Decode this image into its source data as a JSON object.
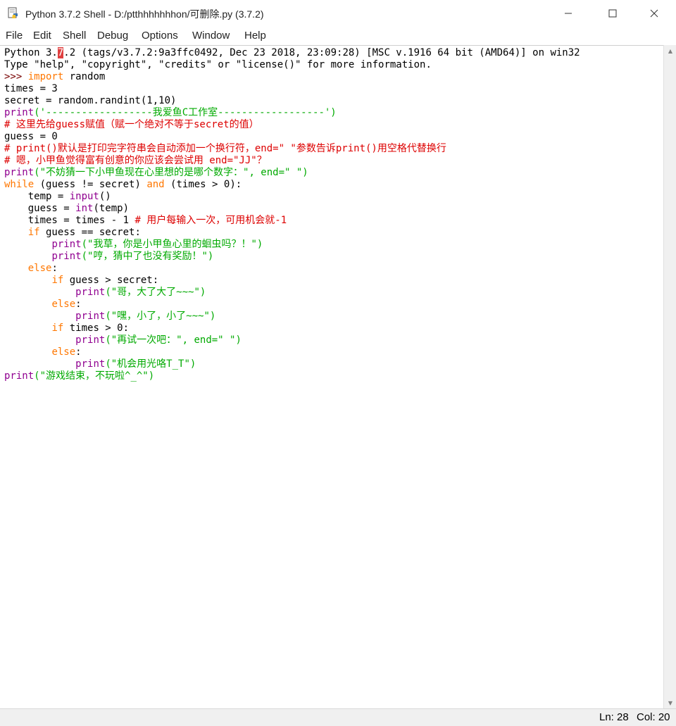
{
  "window": {
    "title": "Python 3.7.2 Shell - D:/ptthhhhhhhon/可删除.py (3.7.2)",
    "minimize_icon": "minimize-icon",
    "maximize_icon": "maximize-icon",
    "close_icon": "close-icon"
  },
  "menu": {
    "items": [
      "File",
      "Edit",
      "Shell",
      "Debug",
      "Options",
      "Window",
      "Help"
    ]
  },
  "editor": {
    "lines": [
      [
        {
          "t": "Python 3."
        },
        {
          "t": "7",
          "c": "cur"
        },
        {
          "t": ".2 (tags/v3.7.2:9a3ffc0492, Dec 23 2018, 23:09:28) [MSC v.1916 64 bit (AMD64)] on win32"
        }
      ],
      [
        {
          "t": "Type \"help\", \"copyright\", \"credits\" or \"license()\" for more information."
        }
      ],
      [
        {
          "t": ">>> ",
          "c": "prompt"
        },
        {
          "t": "import",
          "c": "kw"
        },
        {
          "t": " random"
        }
      ],
      [
        {
          "t": "times = 3"
        }
      ],
      [
        {
          "t": "secret = random.randint(1,10)"
        }
      ],
      [
        {
          "t": "print",
          "c": "bi"
        },
        {
          "t": "('------------------我爱鱼C工作室------------------')",
          "c": "str"
        }
      ],
      [
        {
          "t": "# 这里先给guess赋值（赋一个绝对不等于secret的值）",
          "c": "cm"
        }
      ],
      [
        {
          "t": "guess = 0"
        }
      ],
      [
        {
          "t": "# print()默认是打印完字符串会自动添加一个换行符，end=\" \"参数告诉print()用空格代替换行",
          "c": "cm"
        }
      ],
      [
        {
          "t": "# 嗯，小甲鱼觉得富有创意的你应该会尝试用 end=\"JJ\"？",
          "c": "cm"
        }
      ],
      [
        {
          "t": "print",
          "c": "bi"
        },
        {
          "t": "(\"不妨猜一下小甲鱼现在心里想的是哪个数字：\", end=\" \")",
          "c": "str"
        }
      ],
      [
        {
          "t": "while",
          "c": "kw"
        },
        {
          "t": " (guess != secret) "
        },
        {
          "t": "and",
          "c": "kw"
        },
        {
          "t": " (times > 0):"
        }
      ],
      [
        {
          "t": "    temp = "
        },
        {
          "t": "input",
          "c": "bi"
        },
        {
          "t": "()"
        }
      ],
      [
        {
          "t": "    guess = "
        },
        {
          "t": "int",
          "c": "bi"
        },
        {
          "t": "(temp)"
        }
      ],
      [
        {
          "t": "    times = times - 1 "
        },
        {
          "t": "# 用户每输入一次，可用机会就-1",
          "c": "cm"
        }
      ],
      [
        {
          "t": "    "
        },
        {
          "t": "if",
          "c": "kw"
        },
        {
          "t": " guess == secret:"
        }
      ],
      [
        {
          "t": "        "
        },
        {
          "t": "print",
          "c": "bi"
        },
        {
          "t": "(\"我草，你是小甲鱼心里的蛔虫吗？！\")",
          "c": "str"
        }
      ],
      [
        {
          "t": "        "
        },
        {
          "t": "print",
          "c": "bi"
        },
        {
          "t": "(\"哼，猜中了也没有奖励！\")",
          "c": "str"
        }
      ],
      [
        {
          "t": "    "
        },
        {
          "t": "else",
          "c": "kw"
        },
        {
          "t": ":"
        }
      ],
      [
        {
          "t": "        "
        },
        {
          "t": "if",
          "c": "kw"
        },
        {
          "t": " guess > secret:"
        }
      ],
      [
        {
          "t": "            "
        },
        {
          "t": "print",
          "c": "bi"
        },
        {
          "t": "(\"哥，大了大了~~~\")",
          "c": "str"
        }
      ],
      [
        {
          "t": "        "
        },
        {
          "t": "else",
          "c": "kw"
        },
        {
          "t": ":"
        }
      ],
      [
        {
          "t": "            "
        },
        {
          "t": "print",
          "c": "bi"
        },
        {
          "t": "(\"嘿，小了，小了~~~\")",
          "c": "str"
        }
      ],
      [
        {
          "t": "        "
        },
        {
          "t": "if",
          "c": "kw"
        },
        {
          "t": " times > 0:"
        }
      ],
      [
        {
          "t": "            "
        },
        {
          "t": "print",
          "c": "bi"
        },
        {
          "t": "(\"再试一次吧：\", end=\" \")",
          "c": "str"
        }
      ],
      [
        {
          "t": "        "
        },
        {
          "t": "else",
          "c": "kw"
        },
        {
          "t": ":"
        }
      ],
      [
        {
          "t": "            "
        },
        {
          "t": "print",
          "c": "bi"
        },
        {
          "t": "(\"机会用光咯T_T\")",
          "c": "str"
        }
      ],
      [
        {
          "t": "print",
          "c": "bi"
        },
        {
          "t": "(\"游戏结束，不玩啦^_^\")",
          "c": "str"
        }
      ]
    ]
  },
  "status": {
    "line": "Ln: 28",
    "col": "Col: 20"
  },
  "colors": {
    "keyword": "#ff7700",
    "builtin": "#900090",
    "string": "#00aa00",
    "comment": "#dd0000",
    "prompt": "#770000"
  }
}
